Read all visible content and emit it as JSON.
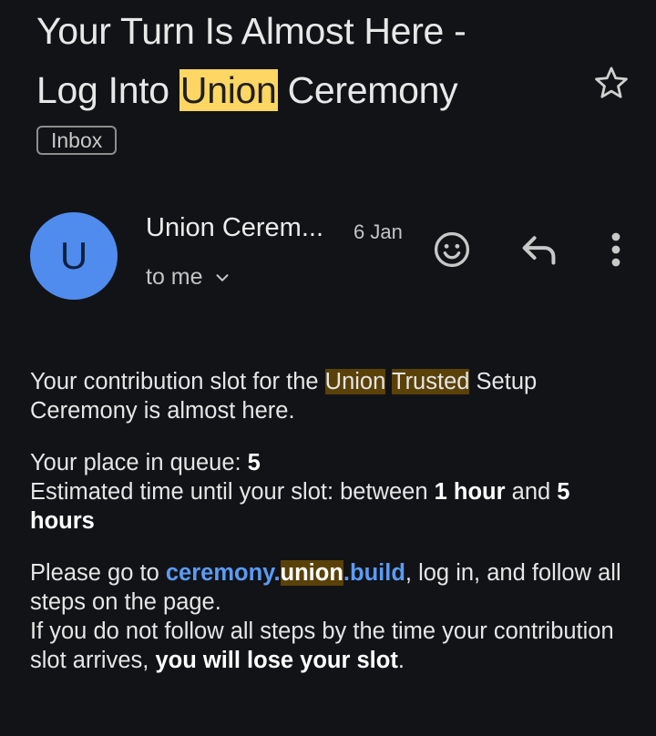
{
  "subject": {
    "line1": "Your Turn Is Almost Here -",
    "line2_pre": "Log Into ",
    "line2_highlight": "Union",
    "line2_post": " Ceremony"
  },
  "label_badge": "Inbox",
  "sender": {
    "avatar_letter": "U",
    "name": "Union Cerem...",
    "date": "6 Jan",
    "recipient": "to me"
  },
  "icons": [
    "star-icon",
    "chevron-down-icon",
    "emoji-reaction-icon",
    "reply-icon",
    "more-vert-icon"
  ],
  "body": {
    "p1_pre": "Your contribution slot for the ",
    "p1_hl1": "Union",
    "p1_hl2": "Trusted",
    "p1_post": " Setup Ceremony is almost here.",
    "queue_label": "Your place in queue: ",
    "queue_value": "5",
    "time_label": "Estimated time until your slot: between ",
    "time_min": "1 hour",
    "time_and": " and ",
    "time_max": "5 hours",
    "p3_pre": "Please go to ",
    "link_a": "ceremony.",
    "link_hl": "union",
    "link_b": ".build",
    "p3_post": ", log in, and follow all steps on the page.",
    "p4_pre": "If you do not follow all steps by the time your contribution slot arrives, ",
    "p4_bold": "you will lose your slot",
    "p4_end": "."
  },
  "colors": {
    "background": "#121316",
    "title_highlight": "#fdd663",
    "body_highlight": "#5a4108",
    "link": "#5a9cf5",
    "avatar": "#4f8cee"
  }
}
